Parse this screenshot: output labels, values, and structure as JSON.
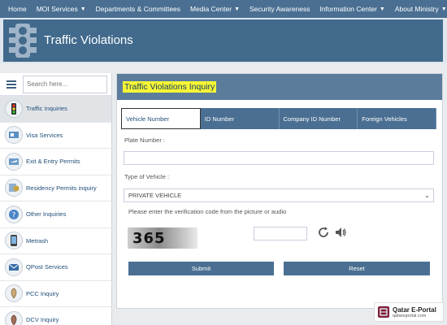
{
  "topnav": {
    "items": [
      {
        "label": "Home",
        "has_dropdown": false
      },
      {
        "label": "MOI Services",
        "has_dropdown": true
      },
      {
        "label": "Departments & Committees",
        "has_dropdown": false
      },
      {
        "label": "Media Center",
        "has_dropdown": true
      },
      {
        "label": "Security Awareness",
        "has_dropdown": false
      },
      {
        "label": "Information Center",
        "has_dropdown": true
      },
      {
        "label": "About Ministry",
        "has_dropdown": true
      }
    ]
  },
  "header": {
    "title": "Traffic Violations"
  },
  "sidebar": {
    "search_placeholder": "Search here...",
    "items": [
      {
        "label": "Traffic Inquiries",
        "icon": "traffic-light-icon",
        "active": true
      },
      {
        "label": "Visa Services",
        "icon": "visa-icon",
        "active": false
      },
      {
        "label": "Exit & Entry Permits",
        "icon": "plane-icon",
        "active": false
      },
      {
        "label": "Residency Permits inquiry",
        "icon": "residency-icon",
        "active": false
      },
      {
        "label": "Other Inquiries",
        "icon": "question-icon",
        "active": false
      },
      {
        "label": "Metrash",
        "icon": "phone-icon",
        "active": false
      },
      {
        "label": "QPost Services",
        "icon": "mail-icon",
        "active": false
      },
      {
        "label": "PCC Inquiry",
        "icon": "certificate-icon",
        "active": false
      },
      {
        "label": "DCV Inquiry",
        "icon": "document-icon",
        "active": false
      }
    ]
  },
  "main": {
    "title": "Traffic Violations Inquiry",
    "tabs": [
      {
        "label": "Vehicle Number",
        "active": true
      },
      {
        "label": "ID Number",
        "active": false
      },
      {
        "label": "Company ID Number",
        "active": false
      },
      {
        "label": "Foreign Vehicles",
        "active": false
      }
    ],
    "plate_label": "Plate Number :",
    "plate_value": "",
    "vehicle_type_label": "Type of Vehicle :",
    "vehicle_type_value": "PRIVATE VEHICLE",
    "captcha_hint": "Please enter the verification code from the picture or audio",
    "captcha_text": "365",
    "captcha_value": "",
    "submit_label": "Submit",
    "reset_label": "Reset"
  },
  "watermark": {
    "title": "Qatar E-Portal",
    "url": "qatareportal.com"
  },
  "colors": {
    "nav": "#4a6f92",
    "banner": "#416a8c",
    "highlight": "#f6f635",
    "link": "#1f4e79"
  }
}
